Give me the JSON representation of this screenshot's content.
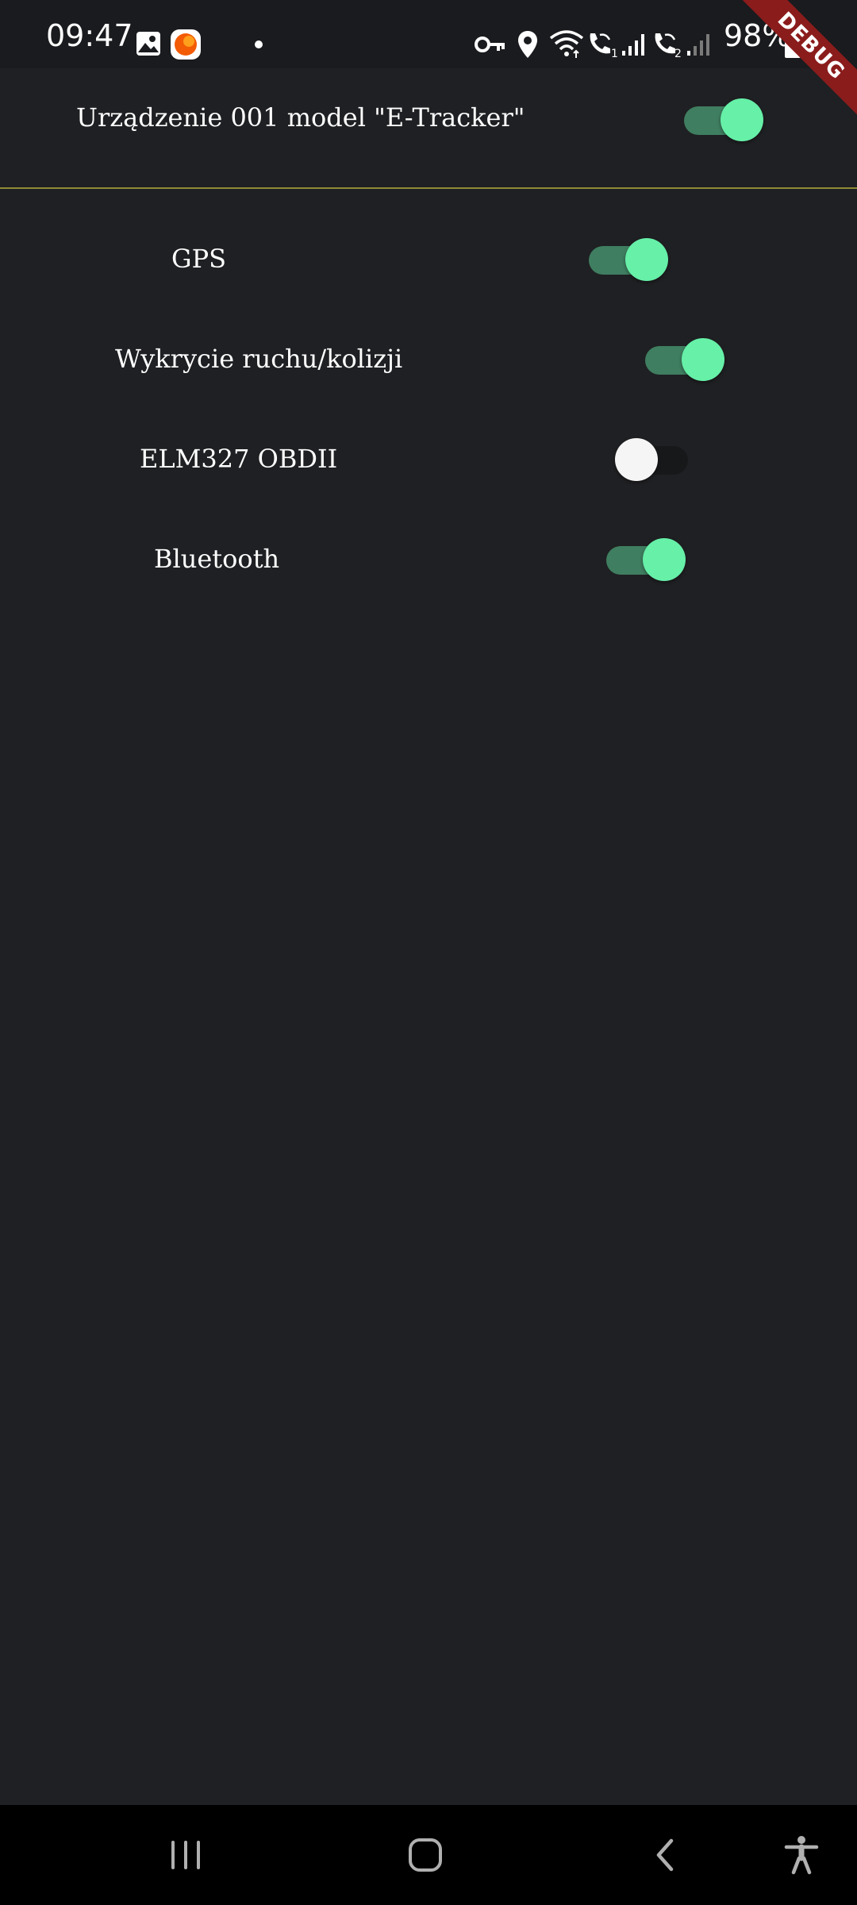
{
  "status_bar": {
    "time": "09:47",
    "battery_percent": "98%",
    "icons": [
      "gallery-icon",
      "app-notification-icon",
      "dot-icon",
      "vpn-key-icon",
      "location-icon",
      "wifi-icon",
      "wifi-call-1-icon",
      "signal-1-icon",
      "wifi-call-2-icon",
      "signal-2-icon",
      "battery-icon"
    ]
  },
  "debug_banner": "DEBUG",
  "device": {
    "label": "Urządzenie 001 model \"E-Tracker\"",
    "enabled": true
  },
  "settings": [
    {
      "label": "GPS",
      "enabled": true
    },
    {
      "label": "Wykrycie ruchu/kolizji",
      "enabled": true
    },
    {
      "label": "ELM327 OBDII",
      "enabled": false
    },
    {
      "label": "Bluetooth",
      "enabled": true
    }
  ],
  "colors": {
    "background": "#1f2023",
    "divider": "#8f8a35",
    "toggle_on_thumb": "#66f0a8",
    "toggle_on_track": "#3f7e60",
    "toggle_off_thumb": "#f5f5f5",
    "toggle_off_track": "#17181a",
    "debug_banner": "#8b1c1c"
  },
  "navigation": {
    "buttons": [
      "recents-icon",
      "home-icon",
      "back-icon",
      "accessibility-icon"
    ]
  }
}
